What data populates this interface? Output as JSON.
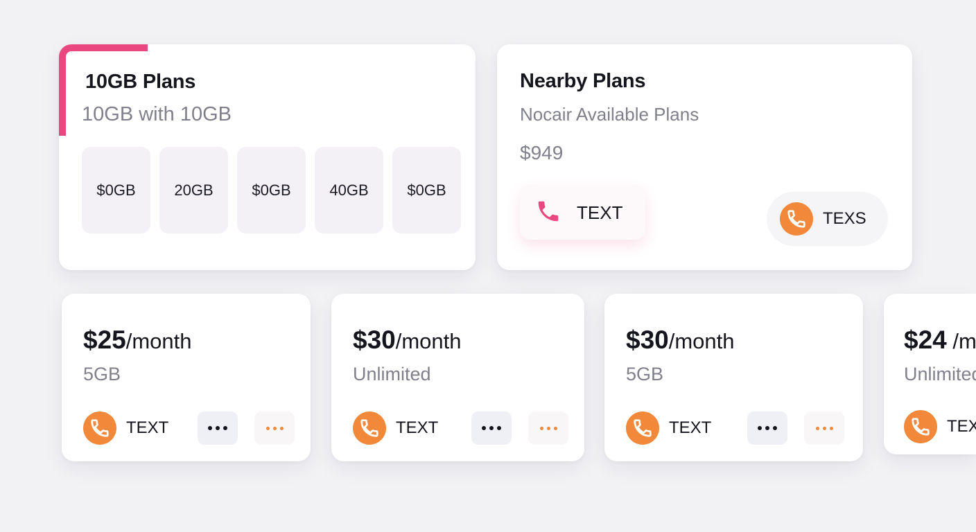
{
  "plans_card": {
    "title": "10GB Plans",
    "subtitle": "10GB with 10GB",
    "chips": [
      "$0GB",
      "20GB",
      "$0GB",
      "40GB",
      "$0GB"
    ]
  },
  "nearby_card": {
    "title": "Nearby Plans",
    "subtitle": "Nocair Available Plans",
    "price": "$949",
    "text_button_label": "TEXT",
    "texs_button_label": "TEXS"
  },
  "plans": [
    {
      "price": "$25",
      "unit": "/month",
      "detail": "5GB",
      "text_label": "TEXT"
    },
    {
      "price": "$30",
      "unit": "/month",
      "detail": "Unlimited",
      "text_label": "TEXT"
    },
    {
      "price": "$30",
      "unit": "/month",
      "detail": "5GB",
      "text_label": "TEXT"
    },
    {
      "price": "$24",
      "unit": " /month",
      "detail": "Unlimited",
      "text_label": "TEXT"
    }
  ],
  "colors": {
    "accent_pink": "#e8487f",
    "accent_orange": "#f1883a"
  },
  "icons": [
    "phone-icon",
    "more-dots-icon"
  ]
}
